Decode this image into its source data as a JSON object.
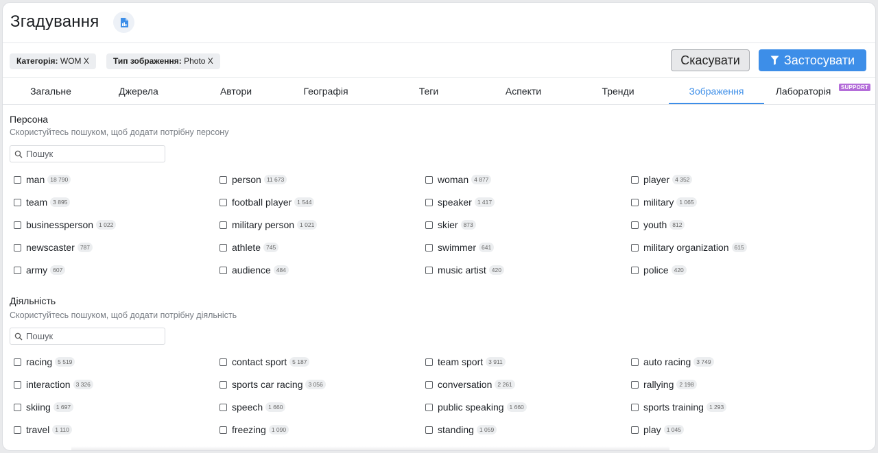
{
  "header": {
    "title": "Згадування"
  },
  "filters": {
    "chips": [
      {
        "key": "Категорія:",
        "value": "WOM X"
      },
      {
        "key": "Тип зображення:",
        "value": "Photo X"
      }
    ],
    "cancel_label": "Скасувати",
    "apply_label": "Застосувати"
  },
  "tabs": [
    {
      "label": "Загальне"
    },
    {
      "label": "Джерела"
    },
    {
      "label": "Автори"
    },
    {
      "label": "Географія"
    },
    {
      "label": "Теги"
    },
    {
      "label": "Аспекти"
    },
    {
      "label": "Тренди"
    },
    {
      "label": "Зображення",
      "active": true
    },
    {
      "label": "Лабораторія",
      "badge": "SUPPORT"
    }
  ],
  "sections": [
    {
      "title": "Персона",
      "hint": "Скористуйтесь пошуком, щоб додати потрібну персону",
      "search_placeholder": "Пошук",
      "items": [
        {
          "label": "man",
          "count": "18 790"
        },
        {
          "label": "person",
          "count": "11 673"
        },
        {
          "label": "woman",
          "count": "4 877"
        },
        {
          "label": "player",
          "count": "4 352"
        },
        {
          "label": "team",
          "count": "3 895"
        },
        {
          "label": "football player",
          "count": "1 544"
        },
        {
          "label": "speaker",
          "count": "1 417"
        },
        {
          "label": "military",
          "count": "1 065"
        },
        {
          "label": "businessperson",
          "count": "1 022"
        },
        {
          "label": "military person",
          "count": "1 021"
        },
        {
          "label": "skier",
          "count": "873"
        },
        {
          "label": "youth",
          "count": "812"
        },
        {
          "label": "newscaster",
          "count": "787"
        },
        {
          "label": "athlete",
          "count": "745"
        },
        {
          "label": "swimmer",
          "count": "641"
        },
        {
          "label": "military organization",
          "count": "615"
        },
        {
          "label": "army",
          "count": "607"
        },
        {
          "label": "audience",
          "count": "484"
        },
        {
          "label": "music artist",
          "count": "420"
        },
        {
          "label": "police",
          "count": "420"
        }
      ]
    },
    {
      "title": "Діяльність",
      "hint": "Скористуйтесь пошуком, щоб додати потрібну діяльність",
      "search_placeholder": "Пошук",
      "items": [
        {
          "label": "racing",
          "count": "5 519"
        },
        {
          "label": "contact sport",
          "count": "5 187"
        },
        {
          "label": "team sport",
          "count": "3 911"
        },
        {
          "label": "auto racing",
          "count": "3 749"
        },
        {
          "label": "interaction",
          "count": "3 326"
        },
        {
          "label": "sports car racing",
          "count": "3 056"
        },
        {
          "label": "conversation",
          "count": "2 261"
        },
        {
          "label": "rallying",
          "count": "2 198"
        },
        {
          "label": "skiing",
          "count": "1 697"
        },
        {
          "label": "speech",
          "count": "1 660"
        },
        {
          "label": "public speaking",
          "count": "1 660"
        },
        {
          "label": "sports training",
          "count": "1 293"
        },
        {
          "label": "travel",
          "count": "1 110"
        },
        {
          "label": "freezing",
          "count": "1 090"
        },
        {
          "label": "standing",
          "count": "1 059"
        },
        {
          "label": "play",
          "count": "1 045"
        }
      ]
    }
  ]
}
